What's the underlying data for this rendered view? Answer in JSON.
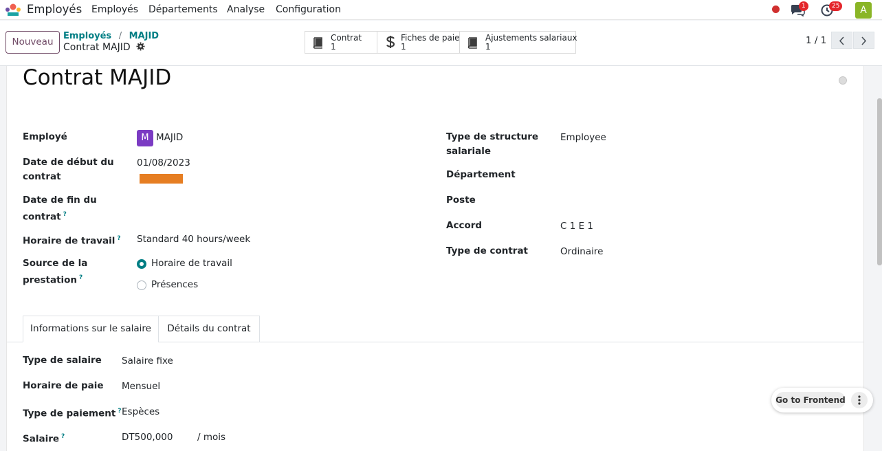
{
  "navbar": {
    "app_name": "Employés",
    "menu": [
      "Employés",
      "Départements",
      "Analyse",
      "Configuration"
    ],
    "messages_badge": "1",
    "activities_badge": "25",
    "user_initial": "A"
  },
  "control_panel": {
    "new_button": "Nouveau",
    "breadcrumb": {
      "parent": "Employés",
      "separator": "/",
      "current_link": "MAJID",
      "record": "Contrat MAJID"
    },
    "smart_buttons": [
      {
        "label": "Contrat",
        "count": "1",
        "icon": "book-icon"
      },
      {
        "label": "Fiches de paie",
        "count": "1",
        "icon": "dollar-icon"
      },
      {
        "label": "Ajustements salariaux",
        "count": "1",
        "icon": "book-icon"
      }
    ],
    "pager": "1 / 1"
  },
  "form": {
    "title": "Contrat MAJID",
    "left_fields": {
      "employee_label": "Employé",
      "employee_initial": "M",
      "employee_value": "MAJID",
      "date_start_label_1": "Date de début du",
      "date_start_label_2": "contrat",
      "date_start_value": "01/08/2023",
      "date_end_label_1": "Date de fin du",
      "date_end_label_2": "contrat",
      "schedule_label": "Horaire de travail",
      "schedule_value": "Standard 40 hours/week",
      "source_label_1": "Source de la",
      "source_label_2": "prestation",
      "source_options": [
        "Horaire de travail",
        "Présences"
      ],
      "source_selected": "Horaire de travail"
    },
    "right_fields": {
      "structure_label_1": "Type de structure",
      "structure_label_2": "salariale",
      "structure_value": "Employee",
      "department_label": "Département",
      "job_label": "Poste",
      "agreement_label": "Accord",
      "agreement_value": "C 1 E 1",
      "contract_type_label": "Type de contrat",
      "contract_type_value": "Ordinaire"
    },
    "help_mark": "?",
    "tabs": [
      "Informations sur le salaire",
      "Détails du contrat"
    ],
    "active_tab": "Informations sur le salaire",
    "salary": {
      "wage_type_label": "Type de salaire",
      "wage_type_value": "Salaire fixe",
      "schedule_pay_label": "Horaire de paie",
      "schedule_pay_value": "Mensuel",
      "payment_type_label": "Type de paiement",
      "payment_type_value": "Espèces",
      "wage_label": "Salaire",
      "wage_value": "DT500,000",
      "wage_unit": "/ mois"
    }
  },
  "frontend": {
    "button": "Go to Frontend"
  },
  "colors": {
    "primary": "#714b67",
    "accent": "#017e84",
    "badge": "#e4262b"
  }
}
